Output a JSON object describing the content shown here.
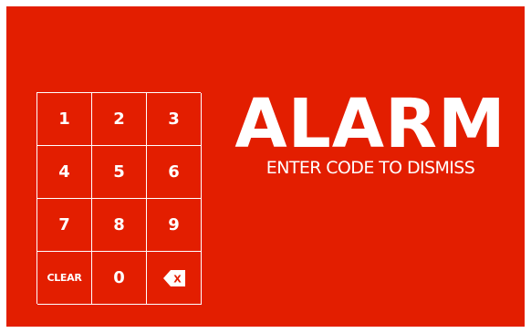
{
  "colors": {
    "background": "#e31e00",
    "foreground": "#ffffff"
  },
  "alarm": {
    "title": "ALARM",
    "subtitle": "ENTER CODE TO DISMISS"
  },
  "keypad": {
    "keys": [
      "1",
      "2",
      "3",
      "4",
      "5",
      "6",
      "7",
      "8",
      "9",
      "CLEAR",
      "0"
    ],
    "backspace_icon": "backspace-icon",
    "backspace_glyph": "X"
  }
}
